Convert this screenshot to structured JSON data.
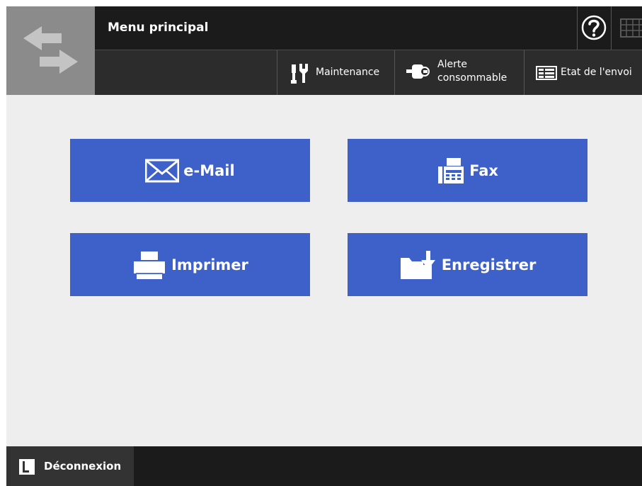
{
  "header": {
    "title": "Menu principal",
    "icons": {
      "logo": "swap-arrows-icon",
      "help": "help-icon",
      "keyboard": "keyboard-icon"
    }
  },
  "toolbar": {
    "maintenance": "Maintenance",
    "consumable_alert": "Alerte\nconsommable",
    "send_status": "Etat de l'envoi"
  },
  "menu": {
    "email": "e-Mail",
    "fax": "Fax",
    "print": "Imprimer",
    "save": "Enregistrer"
  },
  "footer": {
    "logout": "Déconnexion"
  },
  "colors": {
    "accent": "#3d60c9",
    "header_bg": "#1b1b1b",
    "toolbar_bg": "#2c2c2c",
    "content_bg": "#eeeeee",
    "logo_tile": "#8b8b8b"
  }
}
